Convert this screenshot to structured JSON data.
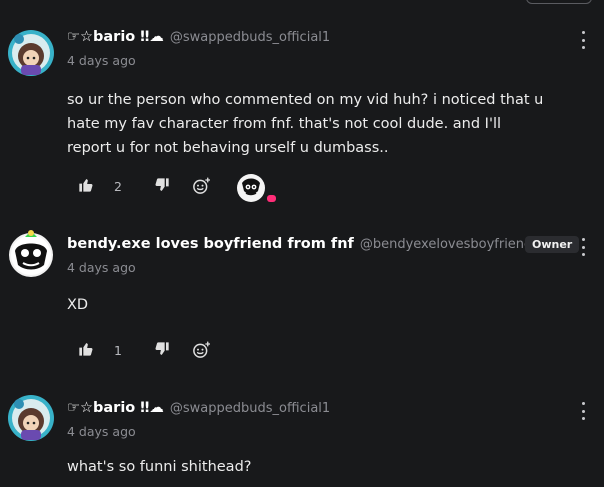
{
  "comments": [
    {
      "author": "☞☆bario ‼☁",
      "handle": "@swappedbuds_official1",
      "time": "4 days ago",
      "text": "so ur the person who commented on my vid huh? i noticed that u hate my fav character from fnf. that's not cool dude. and I'll report u for not behaving urself u dumbass..",
      "likes": "2"
    },
    {
      "author": "bendy.exe loves boyfriend from fnf",
      "handle": "@bendyexelovesboyfriendfro...",
      "badge": "Owner",
      "time": "4 days ago",
      "text": "XD",
      "likes": "1"
    },
    {
      "author": "☞☆bario ‼☁",
      "handle": "@swappedbuds_official1",
      "time": "4 days ago",
      "text": "what's so funni shithead?"
    }
  ],
  "icons": {
    "like": "thumbs-up-icon",
    "dislike": "thumbs-down-icon",
    "react": "add-reaction-icon",
    "menu": "more-vertical-icon"
  },
  "colors": {
    "background": "#18191b",
    "accent_pink": "#ff2d78",
    "badge_bg": "#2b2c30"
  }
}
